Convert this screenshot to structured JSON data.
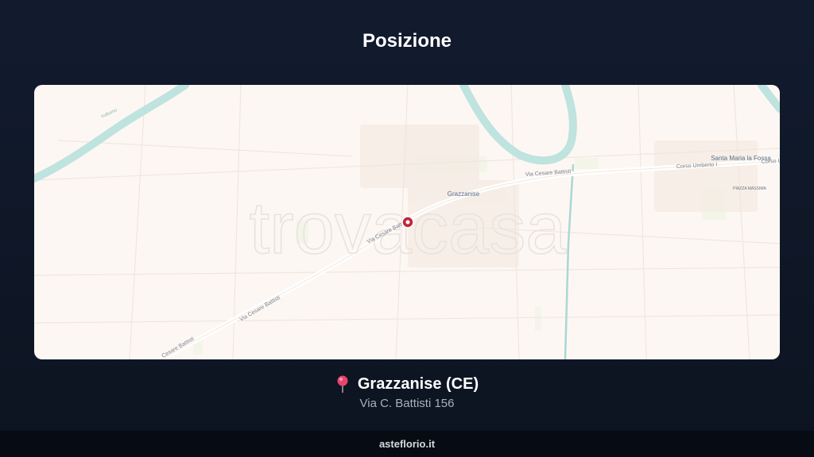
{
  "page": {
    "title": "Posizione"
  },
  "map": {
    "watermark": "trovacasa",
    "labels": {
      "town": "Grazzanise",
      "other_town": "Santa Maria la Fossa",
      "road_1": "Via Cesare Battisti",
      "road_2": "Via Cesare Battisti",
      "road_3": "Via Cesare Battisti",
      "road_4": "Cesare Battisti",
      "road_5": "Corso Umberto I",
      "road_6": "Corso U",
      "square": "PIAZZA MASSIMA",
      "river": "Volturno"
    },
    "marker_icon": "map-marker-icon"
  },
  "location": {
    "city": "Grazzanise (CE)",
    "address": "Via C. Battisti 156",
    "icon": "pushpin-icon"
  },
  "footer": {
    "site": "asteflorio.it"
  },
  "colors": {
    "background": "#111a2c",
    "map_background": "#fdf7f3",
    "river": "#bfe3de",
    "marker": "#c0283c",
    "footer": "#070b13"
  }
}
